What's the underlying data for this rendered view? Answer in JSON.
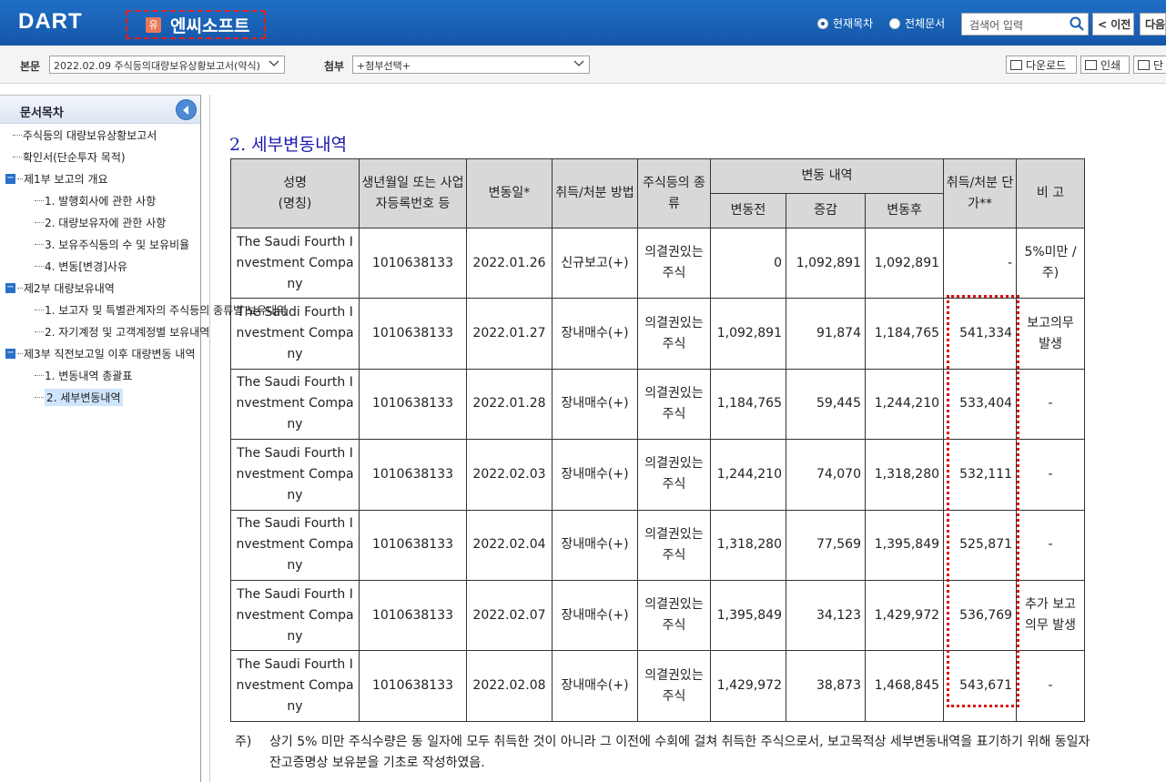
{
  "header": {
    "logo": "DART",
    "company_badge": "유",
    "company_name": "엔씨소프트",
    "radio_current": "현재목차",
    "radio_all": "전체문서",
    "search_placeholder": "검색어 입력",
    "prev_label": "< 이전",
    "next_label": "다음"
  },
  "toolbar": {
    "body_label": "본문",
    "body_select": "2022.02.09  주식등의대량보유상황보고서(약식)",
    "attach_label": "첨부",
    "attach_select": "+첨부선택+",
    "download_label": "다운로드",
    "print_label": "인쇄",
    "third_label": "단"
  },
  "sidebar": {
    "title": "문서목차",
    "items": [
      {
        "label": "주식등의 대량보유상황보고서"
      },
      {
        "label": "확인서(단순투자 목적)"
      },
      {
        "label": "제1부 보고의 개요"
      },
      {
        "label": "1. 발행회사에 관한 사항"
      },
      {
        "label": "2. 대량보유자에 관한 사항"
      },
      {
        "label": "3. 보유주식등의 수 및 보유비율"
      },
      {
        "label": "4. 변동[변경]사유"
      },
      {
        "label": "제2부 대량보유내역"
      },
      {
        "label": "1. 보고자 및 특별관계자의 주식등의 종류별 보유내역"
      },
      {
        "label": "2. 자기계정 및 고객계정별 보유내역"
      },
      {
        "label": "제3부 직전보고일 이후 대량변동 내역"
      },
      {
        "label": "1. 변동내역 총괄표"
      },
      {
        "label": "2. 세부변동내역"
      }
    ]
  },
  "main": {
    "section_title": "2. 세부변동내역",
    "headers": {
      "name": "성명\n(명칭)",
      "regno": "생년월일 또는 사업자등록번호 등",
      "date": "변동일*",
      "method": "취득/처분 방법",
      "kind": "주식등의 종류",
      "change_group": "변동 내역",
      "before": "변동전",
      "delta": "증감",
      "after": "변동후",
      "price": "취득/처분 단가**",
      "note": "비 고"
    },
    "rows": [
      {
        "name": "The Saudi Fourth Investment Company",
        "regno": "1010638133",
        "date": "2022.01.26",
        "method": "신규보고(+)",
        "kind": "의결권있는 주식",
        "before": "0",
        "delta": "1,092,891",
        "after": "1,092,891",
        "price": "-",
        "note": "5%미만 /주)"
      },
      {
        "name": "The Saudi Fourth Investment Company",
        "regno": "1010638133",
        "date": "2022.01.27",
        "method": "장내매수(+)",
        "kind": "의결권있는 주식",
        "before": "1,092,891",
        "delta": "91,874",
        "after": "1,184,765",
        "price": "541,334",
        "note": "보고의무 발생"
      },
      {
        "name": "The Saudi Fourth Investment Company",
        "regno": "1010638133",
        "date": "2022.01.28",
        "method": "장내매수(+)",
        "kind": "의결권있는 주식",
        "before": "1,184,765",
        "delta": "59,445",
        "after": "1,244,210",
        "price": "533,404",
        "note": "-"
      },
      {
        "name": "The Saudi Fourth Investment Company",
        "regno": "1010638133",
        "date": "2022.02.03",
        "method": "장내매수(+)",
        "kind": "의결권있는 주식",
        "before": "1,244,210",
        "delta": "74,070",
        "after": "1,318,280",
        "price": "532,111",
        "note": "-"
      },
      {
        "name": "The Saudi Fourth Investment Company",
        "regno": "1010638133",
        "date": "2022.02.04",
        "method": "장내매수(+)",
        "kind": "의결권있는 주식",
        "before": "1,318,280",
        "delta": "77,569",
        "after": "1,395,849",
        "price": "525,871",
        "note": "-"
      },
      {
        "name": "The Saudi Fourth Investment Company",
        "regno": "1010638133",
        "date": "2022.02.07",
        "method": "장내매수(+)",
        "kind": "의결권있는 주식",
        "before": "1,395,849",
        "delta": "34,123",
        "after": "1,429,972",
        "price": "536,769",
        "note": "추가 보고의무 발생"
      },
      {
        "name": "The Saudi Fourth Investment Company",
        "regno": "1010638133",
        "date": "2022.02.08",
        "method": "장내매수(+)",
        "kind": "의결권있는 주식",
        "before": "1,429,972",
        "delta": "38,873",
        "after": "1,468,845",
        "price": "543,671",
        "note": "-"
      }
    ],
    "footnote_mark": "주)",
    "footnote_text": "상기 5% 미만 주식수량은 동 일자에 모두 취득한 것이 아니라 그 이전에 수회에 걸쳐 취득한 주식으로서, 보고목적상 세부변동내역을 표기하기 위해 동일자 잔고증명상 보유분을 기초로 작성하였음."
  }
}
